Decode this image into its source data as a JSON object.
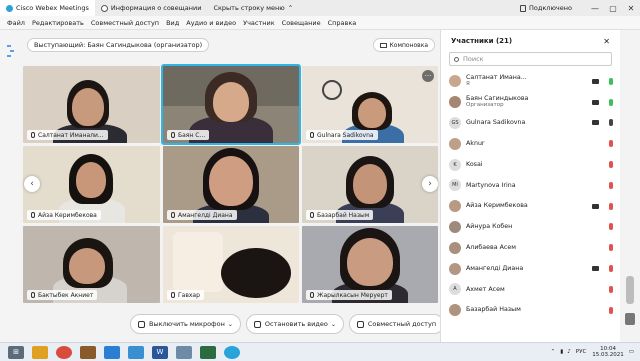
{
  "titlebar": {
    "tabs": [
      "Cisco Webex Meetings",
      "Информация о совещании",
      "Скрыть строку меню"
    ],
    "status": "Подключено",
    "window": {
      "minimize": "—",
      "maximize": "▢",
      "close": "✕"
    }
  },
  "menu": [
    "Файл",
    "Редактировать",
    "Совместный доступ",
    "Вид",
    "Аудио и видео",
    "Участник",
    "Совещание",
    "Справка"
  ],
  "stage": {
    "speaker": "Выступающий: Баян Сагиндыкова (организатор)",
    "layout_button": "Компоновка",
    "tiles": [
      {
        "name": "Салтанат Иманали..."
      },
      {
        "name": "Баян С..."
      },
      {
        "name": "Gulnara Sadikovna"
      },
      {
        "name": "Айза Керимбекова"
      },
      {
        "name": "Амангелді Диана"
      },
      {
        "name": "Базарбай Назым"
      },
      {
        "name": "Бактыбек Акниет"
      },
      {
        "name": "Гавхар"
      },
      {
        "name": "Жарылкасын Меруерт"
      }
    ],
    "more_glyph": "···",
    "prev_glyph": "‹",
    "next_glyph": "›"
  },
  "controls": {
    "mic": "Выключить микрофон",
    "video": "Остановить видео",
    "share": "Совместный доступ",
    "reactions_glyph": "☺",
    "more_glyph": "···",
    "hangup_glyph": "✕",
    "participants_glyph": "👤",
    "chat_glyph": "💬",
    "options_glyph": "···"
  },
  "panel": {
    "title": "Участники (21)",
    "close_glyph": "✕",
    "search_placeholder": "Поиск",
    "participants": [
      {
        "initials": "",
        "name": "Салтанат Имана...",
        "sub": "Я",
        "mic": "green"
      },
      {
        "initials": "",
        "name": "Баян Сагиндыкова",
        "sub": "Организатор",
        "mic": "green"
      },
      {
        "initials": "GS",
        "name": "Gulnara Sadikovna",
        "sub": "",
        "mic": "dark"
      },
      {
        "initials": "",
        "name": "Aknur",
        "sub": "",
        "mic": "red"
      },
      {
        "initials": "K",
        "name": "Kosai",
        "sub": "",
        "mic": "red"
      },
      {
        "initials": "MI",
        "name": "Martynova Irina",
        "sub": "",
        "mic": "red"
      },
      {
        "initials": "",
        "name": "Айза Керимбекова",
        "sub": "",
        "mic": "red"
      },
      {
        "initials": "",
        "name": "Айнура Кобен",
        "sub": "",
        "mic": "red"
      },
      {
        "initials": "",
        "name": "Алибаева Асем",
        "sub": "",
        "mic": "red"
      },
      {
        "initials": "",
        "name": "Амангелді Диана",
        "sub": "",
        "mic": "red"
      },
      {
        "initials": "A",
        "name": "Ахмет Асем",
        "sub": "",
        "mic": "red"
      },
      {
        "initials": "",
        "name": "Базарбай Назым",
        "sub": "",
        "mic": "red"
      }
    ]
  },
  "taskbar": {
    "lang": "РУС",
    "time": "10:04",
    "date": "15.03.2021",
    "app_labels": [
      "W"
    ]
  },
  "colors": {
    "active_outline": "#2fb5e6",
    "hangup": "#e12d1d",
    "mic_muted": "#e35050",
    "mic_on": "#3cbf5a"
  }
}
